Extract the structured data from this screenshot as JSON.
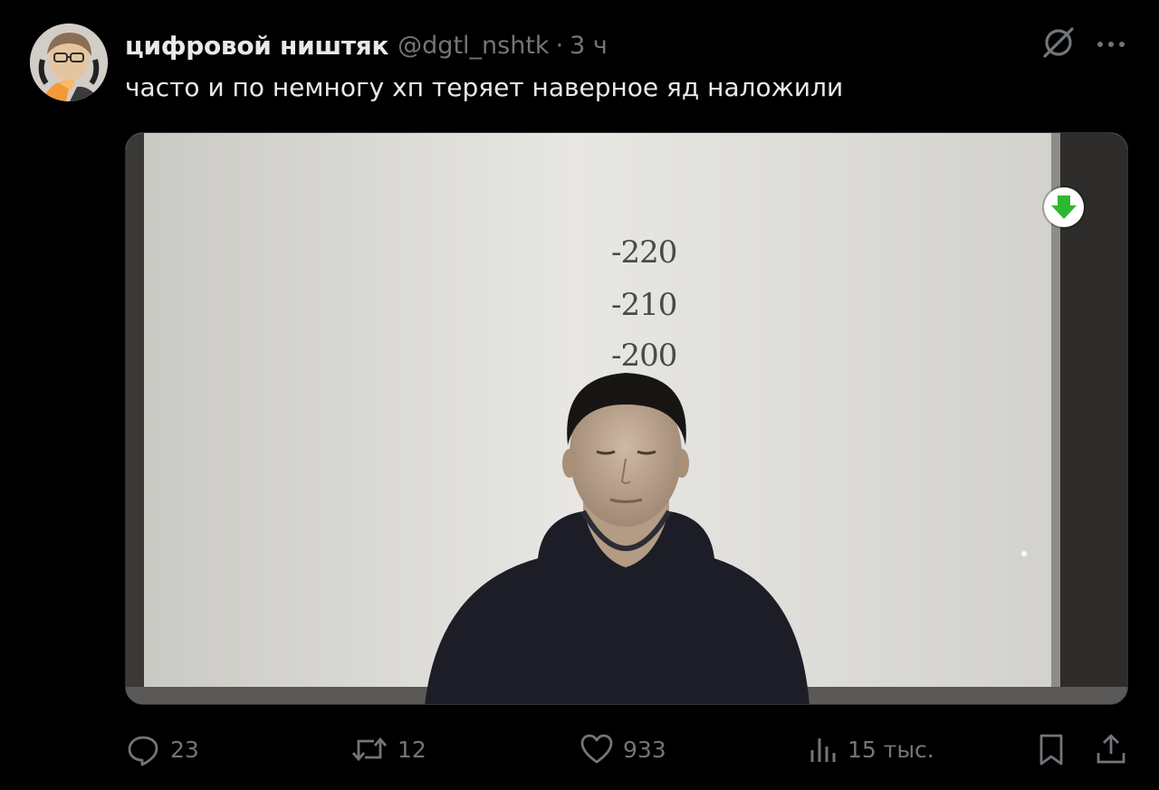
{
  "author": {
    "display_name": "цифровой ништяк",
    "handle": "@dgtl_nshtk",
    "separator": "·",
    "time": "3 ч",
    "avatar": "avatar-photo"
  },
  "tweet": {
    "text": "часто и по немногу хп теряет наверное яд наложили"
  },
  "media": {
    "height_marks": [
      "-220",
      "-210",
      "-200"
    ],
    "badge": "download-arrow-icon",
    "badge_color": "#2fb82f"
  },
  "actions": {
    "reply_count": "23",
    "retweet_count": "12",
    "like_count": "933",
    "views_count": "15 тыс."
  },
  "icons": {
    "top_right": [
      "grok-icon",
      "more-icon"
    ],
    "bar": [
      "reply-icon",
      "retweet-icon",
      "like-icon",
      "views-icon",
      "bookmark-icon",
      "share-icon"
    ]
  },
  "colors": {
    "background": "#000000",
    "text_primary": "#e7e9ea",
    "text_secondary": "#71767b",
    "border": "#2f3336"
  }
}
